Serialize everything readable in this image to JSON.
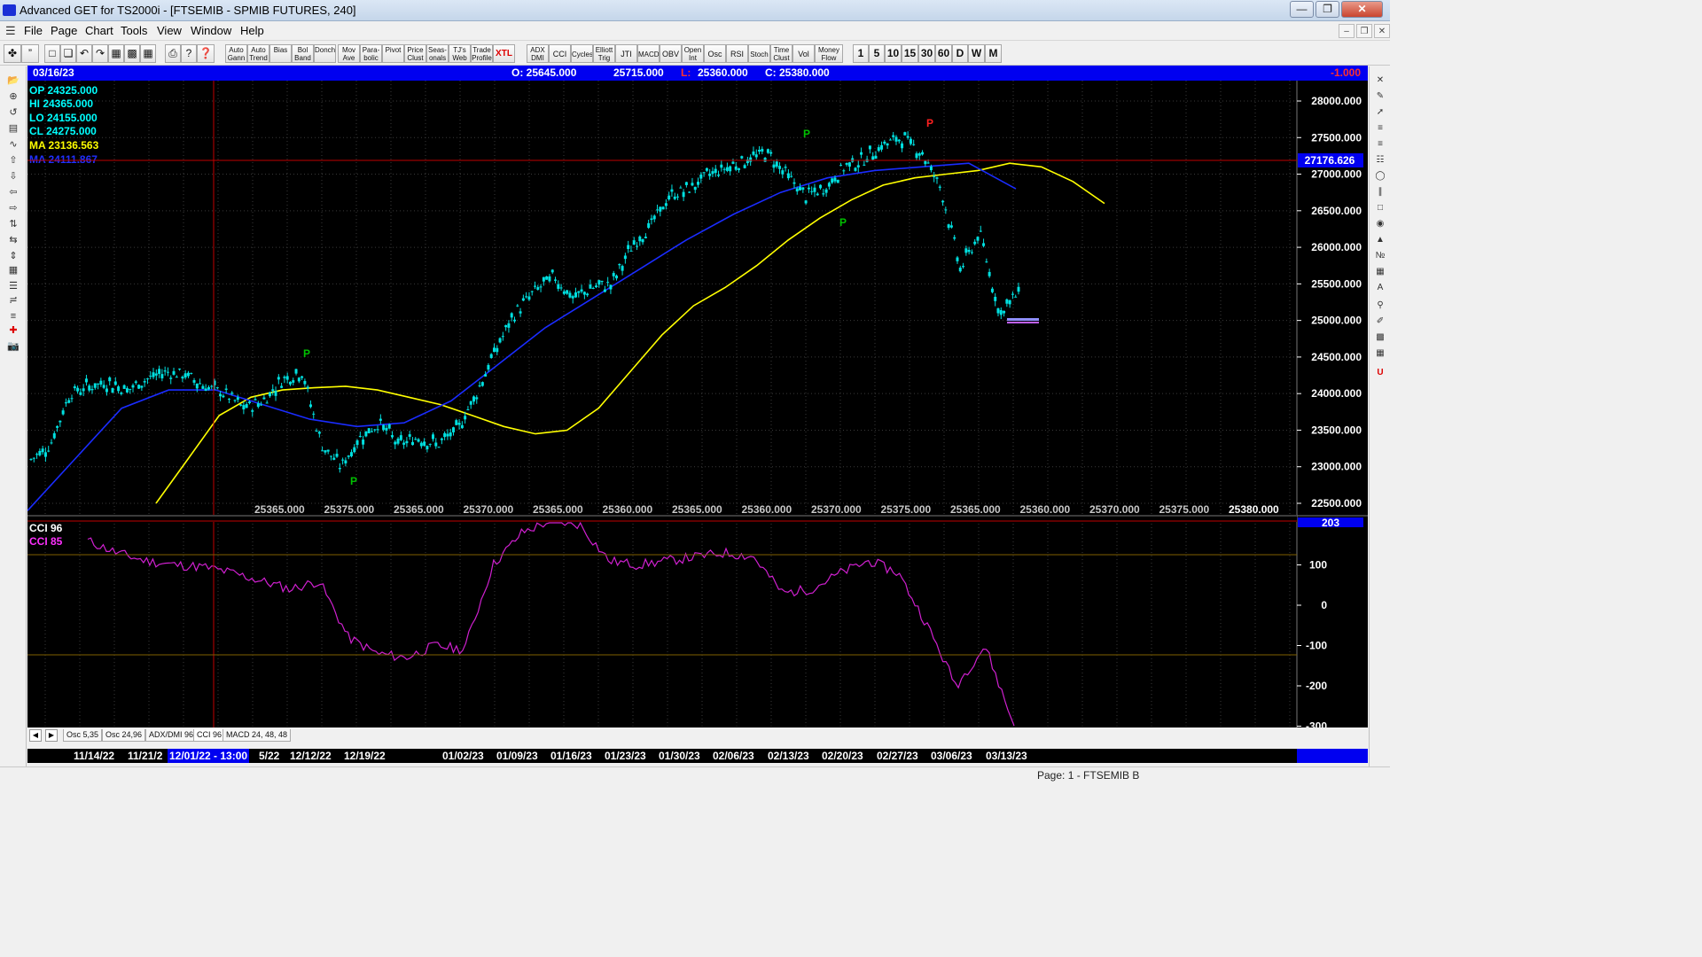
{
  "window": {
    "title": "Advanced GET for TS2000i - [FTSEMIB - SPMIB FUTURES, 240]",
    "minimize_icon": "minimize-icon",
    "maximize_icon": "maximize-icon",
    "close_icon": "close-icon"
  },
  "menu": {
    "items": [
      "File",
      "Page",
      "Chart",
      "Tools",
      "View",
      "Window",
      "Help"
    ]
  },
  "toolbar": {
    "small_buttons": [
      {
        "label": "Auto\nGann"
      },
      {
        "label": "Auto\nTrend"
      },
      {
        "label": "Bias"
      },
      {
        "label": "Bol\nBand"
      },
      {
        "label": "Donch"
      },
      {
        "label": "Mov\nAve"
      },
      {
        "label": "Para-\nbolic"
      },
      {
        "label": "Pivot"
      },
      {
        "label": "Price\nClust"
      },
      {
        "label": "Seas-\nonals"
      },
      {
        "label": "TJ's\nWeb"
      },
      {
        "label": "Trade\nProfile"
      },
      {
        "label": "XTL"
      },
      {
        "label": "ADX\nDMI"
      },
      {
        "label": "CCI"
      },
      {
        "label": "Cycles"
      },
      {
        "label": "Elliott\nTrig"
      },
      {
        "label": "JTI"
      },
      {
        "label": "MACD"
      },
      {
        "label": "OBV"
      },
      {
        "label": "Open\nInt"
      },
      {
        "label": "Osc"
      },
      {
        "label": "RSI"
      },
      {
        "label": "Stoch"
      },
      {
        "label": "Time\nClust"
      },
      {
        "label": "Vol"
      },
      {
        "label": "Money\nFlow"
      }
    ],
    "intervals": [
      "1",
      "5",
      "10",
      "15",
      "30",
      "60",
      "D",
      "W",
      "M"
    ]
  },
  "infobar": {
    "date": "03/16/23",
    "open": "O: 25645.000",
    "high": "25715.000",
    "low_label": "L:",
    "low": "25360.000",
    "close": "C: 25380.000",
    "change": "-1.000"
  },
  "stats": {
    "op": "OP  24325.000",
    "hi": "HI   24365.000",
    "lo": "LO  24155.000",
    "cl": "CL  24275.000",
    "ma1": "MA  23136.563",
    "ma2": "MA  24111.867"
  },
  "price_axis": {
    "ticks": [
      "28000.000",
      "27500.000",
      "27000.000",
      "26500.000",
      "26000.000",
      "25500.000",
      "25000.000",
      "24500.000",
      "24000.000",
      "23500.000",
      "23000.000",
      "22500.000"
    ],
    "cursor_value": "27176.626"
  },
  "bottom_price_labels": [
    "25365.000",
    "25375.000",
    "25365.000",
    "25370.000",
    "25365.000",
    "25360.000",
    "25365.000",
    "25360.000",
    "25370.000",
    "25375.000",
    "25365.000",
    "25360.000",
    "25370.000",
    "25375.000",
    "25380.000"
  ],
  "pivot_markers": [
    "P",
    "P",
    "P",
    "P",
    "P"
  ],
  "cci_panel": {
    "label1": "CCI 96",
    "label2": "CCI  85",
    "ticks": [
      "100",
      "0",
      "-100",
      "-200",
      "-300"
    ],
    "top_value": "203"
  },
  "tabs": [
    "Osc 5,35",
    "Osc 24,96",
    "ADX/DMI 96",
    "CCI 96",
    "MACD 24, 48, 48"
  ],
  "dates": [
    "11/14/22",
    "11/21/2",
    "5/22",
    "12/12/22",
    "12/19/22",
    "01/02/23",
    "01/09/23",
    "01/16/23",
    "01/23/23",
    "01/30/23",
    "02/06/23",
    "02/13/23",
    "02/20/23",
    "02/27/23",
    "03/06/23",
    "03/13/23"
  ],
  "cursor_date": "12/01/22 - 13:00",
  "status": "Page: 1 - FTSEMIB B",
  "chart_data": {
    "type": "candlestick",
    "title": "FTSEMIB - SPMIB FUTURES, 240",
    "ylim": [
      22500,
      28000
    ],
    "series": [
      {
        "name": "Price close",
        "values": [
          23100,
          23300,
          24000,
          24100,
          24150,
          24050,
          24200,
          24300,
          24250,
          24100,
          24000,
          23800,
          23900,
          24200,
          24300,
          23300,
          23000,
          23400,
          23600,
          23300,
          23400,
          23300,
          23500,
          24000,
          24600,
          25100,
          25400,
          25600,
          25300,
          25450,
          25500,
          26000,
          26300,
          26700,
          26800,
          27000,
          27100,
          27200,
          27300,
          27000,
          26700,
          26800,
          27100,
          27200,
          27400,
          27500,
          27300,
          26800,
          25700,
          26200,
          25100,
          25380
        ]
      },
      {
        "name": "MA",
        "values": [
          22500,
          23100,
          23700,
          23950,
          24050,
          24080,
          24100,
          24050,
          23950,
          23850,
          23700,
          23550,
          23450,
          23500,
          23800,
          24300,
          24800,
          25200,
          25450,
          25750,
          26100,
          26400,
          26650,
          26850,
          26950,
          27000,
          27050,
          27150,
          27100,
          26900,
          26600
        ]
      },
      {
        "name": "MA",
        "values": [
          22400,
          23100,
          23800,
          24050,
          24050,
          23850,
          23650,
          23550,
          23600,
          23900,
          24400,
          24900,
          25300,
          25700,
          26100,
          26450,
          26750,
          26950,
          27050,
          27100,
          27150,
          26800
        ]
      },
      {
        "name": "CCI",
        "values": [
          160,
          130,
          110,
          100,
          95,
          80,
          60,
          40,
          60,
          -80,
          -120,
          -130,
          -100,
          -110,
          100,
          180,
          210,
          200,
          110,
          100,
          110,
          120,
          130,
          120,
          30,
          40,
          80,
          110,
          80,
          -50,
          -200,
          -100,
          -300
        ]
      }
    ]
  }
}
